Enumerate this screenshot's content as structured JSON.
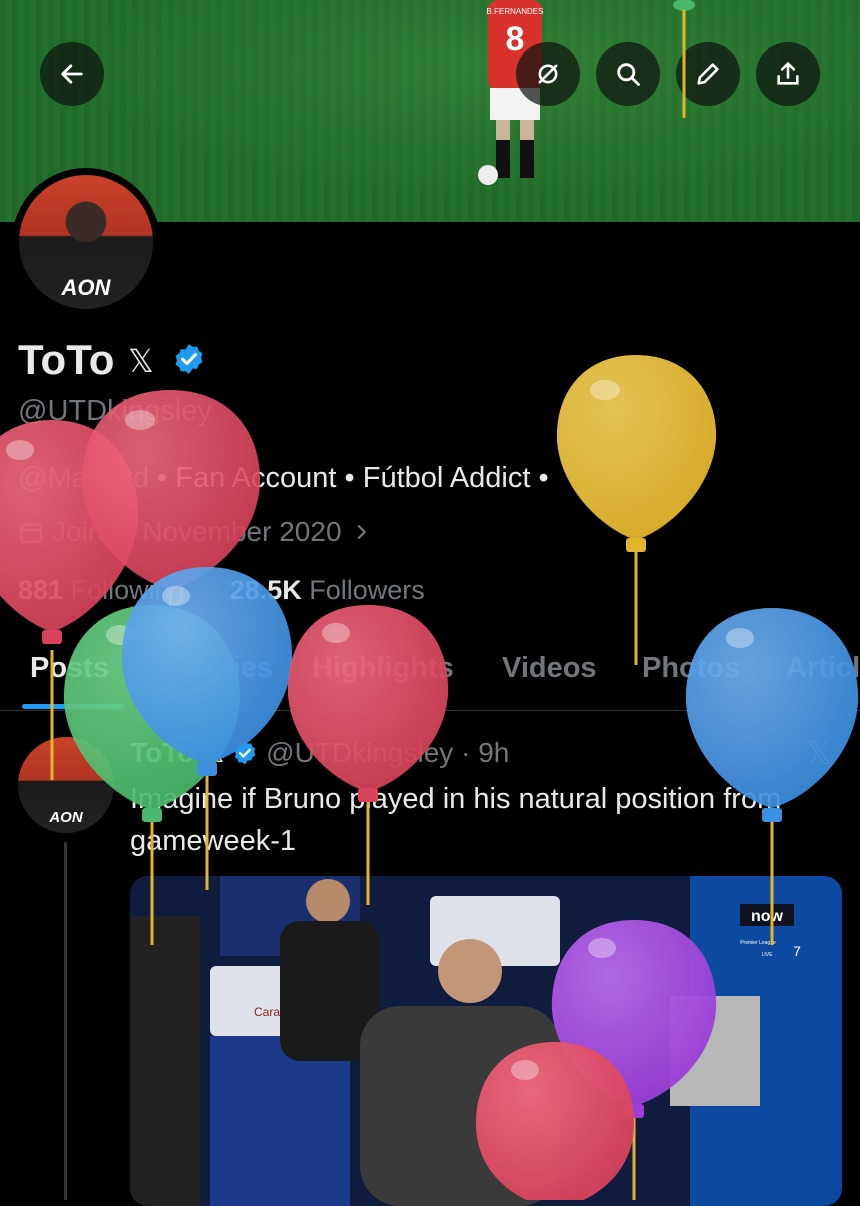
{
  "colors": {
    "background": "#000000",
    "primary_text": "#e7e9ea",
    "secondary_text": "#71767b",
    "accent": "#1d9bf0",
    "balloon_red": "#d8435b",
    "balloon_blue": "#3d8fe0",
    "balloon_green": "#49b86b",
    "balloon_yellow": "#e3b52d",
    "balloon_purple": "#9b3fd6"
  },
  "banner": {
    "jersey_name": "B.FERNANDES",
    "jersey_number": "8",
    "buttons": [
      {
        "icon": "back-arrow-icon"
      },
      {
        "icon": "mute-icon"
      },
      {
        "icon": "search-icon"
      },
      {
        "icon": "edit-pencil-icon"
      },
      {
        "icon": "share-icon"
      }
    ]
  },
  "profile": {
    "avatar_sponsor": "AON",
    "name": "ToTo",
    "badge_x": "𝕏",
    "handle": "@UTDkingsley",
    "bio_tag": "@ManUtd",
    "bio_rest": " • Fan Account • Fútbol Addict • ",
    "joined": "Joined November 2020",
    "following_count": "881",
    "following_label": "Following",
    "followers_count": "28.5K",
    "followers_label": "Followers"
  },
  "tabs": [
    "Posts",
    "Replies",
    "Highlights",
    "Videos",
    "Photos",
    "Articles"
  ],
  "post": {
    "name": "ToTo",
    "badge_x": "𝕏",
    "handle": "@UTDkingsley",
    "time": "· 9h",
    "text": "Imagine if Bruno played in his natural position from gameweek-1",
    "media_bug": "now",
    "media_bug_sub": "Premier League",
    "media_bug_live": "LIVE",
    "media_bug_num": "7",
    "seat_brand": "Carabao",
    "x_logo": "𝕏"
  }
}
